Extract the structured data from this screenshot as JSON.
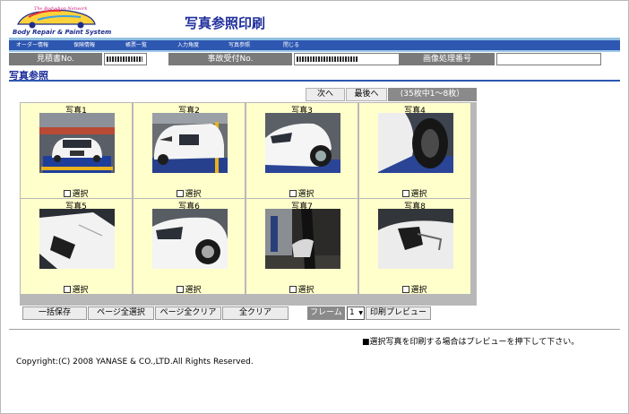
{
  "header": {
    "logo_tagline": "The Bodyshop Network",
    "logo_brand": "Body Repair & Paint System",
    "title": "写真参照印刷"
  },
  "nav": {
    "items": [
      "オーダー情報",
      "保険情報",
      "帳票一覧",
      "入力角度",
      "写真参照",
      "閉じる"
    ]
  },
  "info": {
    "estimate_label": "見積書No.",
    "estimate_value": "",
    "accident_label": "事故受付No.",
    "accident_value": "",
    "image_label": "画像処理番号",
    "image_value": ""
  },
  "section": {
    "title": "写真参照"
  },
  "pagination": {
    "next_label": "次へ",
    "last_label": "最後へ",
    "count_text": "(35枚中1～8枚）"
  },
  "photos": [
    {
      "title": "写真1",
      "select_label": "選択"
    },
    {
      "title": "写真2",
      "select_label": "選択"
    },
    {
      "title": "写真3",
      "select_label": "選択"
    },
    {
      "title": "写真4",
      "select_label": "選択"
    },
    {
      "title": "写真5",
      "select_label": "選択"
    },
    {
      "title": "写真6",
      "select_label": "選択"
    },
    {
      "title": "写真7",
      "select_label": "選択"
    },
    {
      "title": "写真8",
      "select_label": "選択"
    }
  ],
  "actions": {
    "bulk_save": "一括保存",
    "select_page": "ページ全選択",
    "clear_page": "ページ全クリア",
    "clear_all": "全クリア",
    "frame_label": "フレーム",
    "frame_value": "1",
    "print_preview": "印刷プレビュー"
  },
  "footer": {
    "note": "■選択写真を印刷する場合はプレビューを押下して下さい。",
    "copyright": "Copyright:(C) 2008 YANASE & CO.,LTD.All Rights Reserved."
  },
  "colors": {
    "accent": "#1f2f9b",
    "nav_bg": "#2e57b2",
    "grid_bg": "#b8b8b8",
    "cell_bg": "#ffffcc"
  }
}
